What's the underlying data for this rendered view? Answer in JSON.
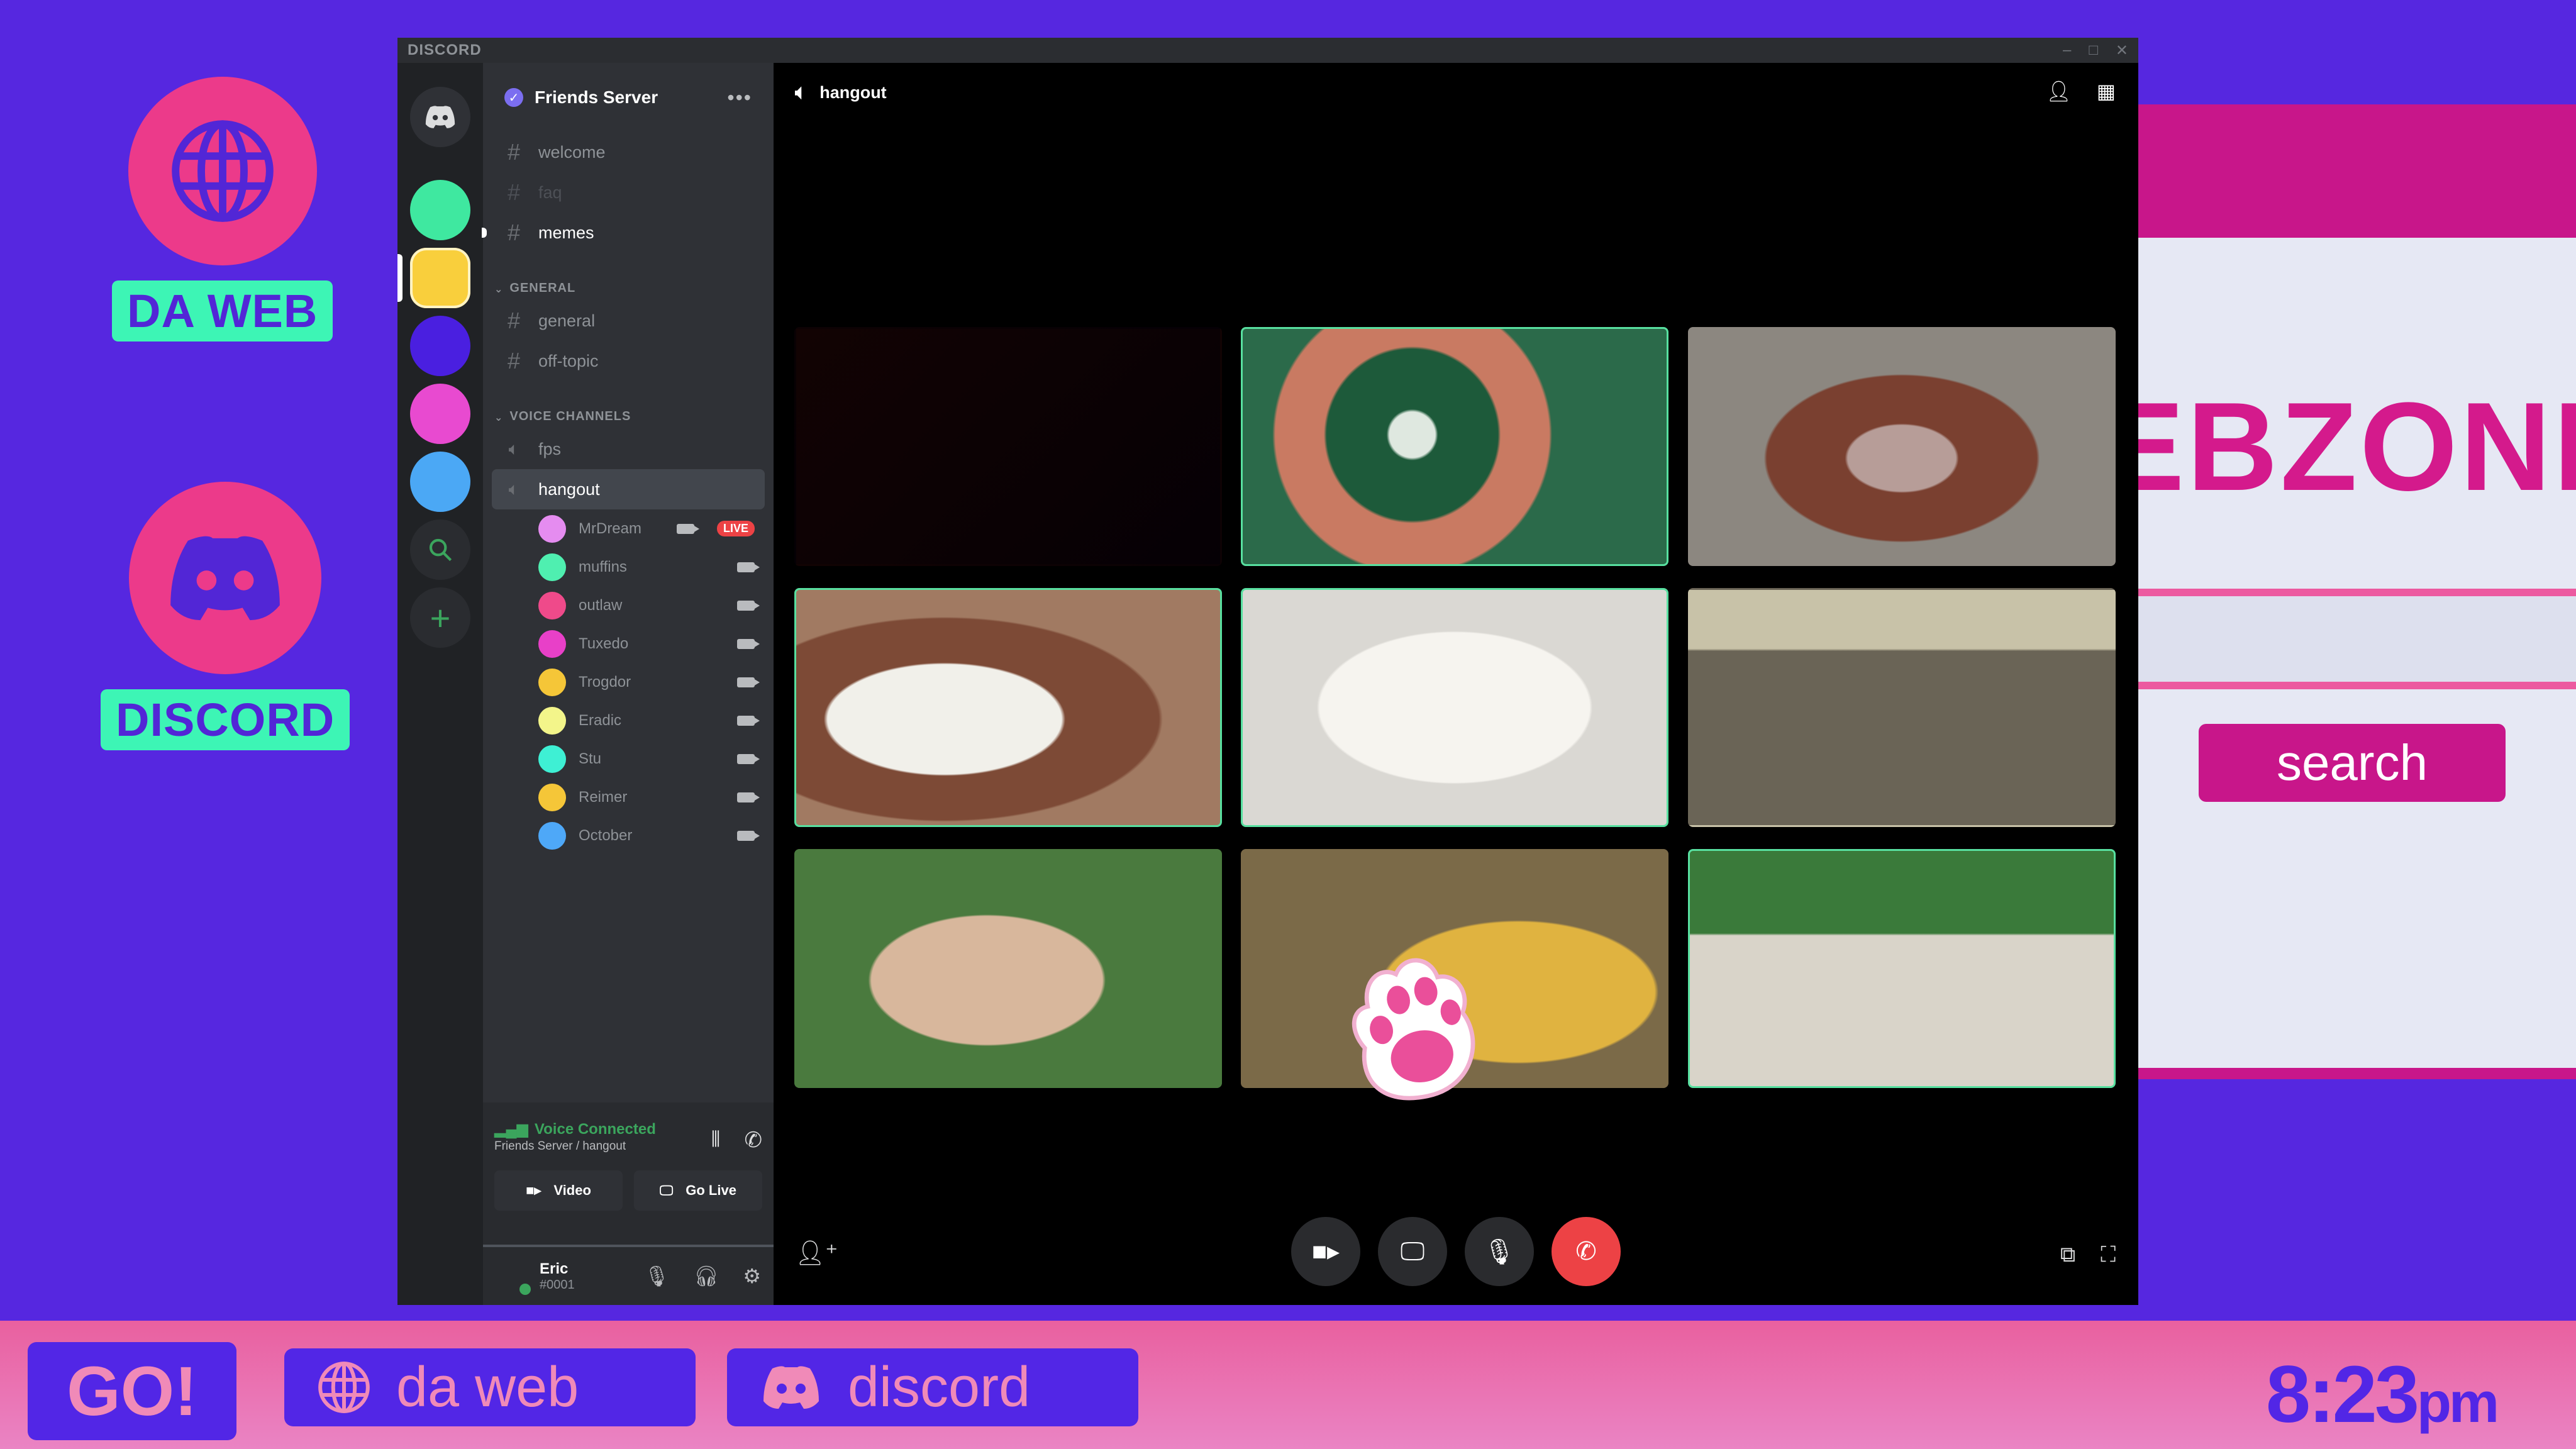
{
  "desktop": {
    "launchers": [
      {
        "label": "DA WEB",
        "icon": "globe-icon"
      },
      {
        "label": "DISCORD",
        "icon": "discord-logo-icon"
      }
    ],
    "colors": {
      "background": "#5627e0",
      "launcher_circle": "#ec3a8a",
      "launcher_tag": "#3df5b5"
    }
  },
  "webzone": {
    "logo_text": "EBZONE",
    "search_button": "search",
    "colors": {
      "brand": "#c8168a",
      "page": "#e6e8f4"
    }
  },
  "discord": {
    "window_title": "DISCORD",
    "window_controls": [
      "–",
      "□",
      "✕"
    ],
    "server_rail": {
      "home_icon": "discord-logo-icon",
      "servers": [
        {
          "color": "#3fe8a0",
          "active": false
        },
        {
          "color": "#f9cf3c",
          "active": true
        },
        {
          "color": "#4a1fe0",
          "active": false
        },
        {
          "color": "#e84ad0",
          "active": false
        },
        {
          "color": "#4ba8f5",
          "active": false
        }
      ],
      "tools": [
        {
          "name": "explore",
          "glyph": "⌕"
        },
        {
          "name": "add-server",
          "glyph": "+"
        }
      ]
    },
    "server": {
      "name": "Friends Server",
      "more_glyph": "•••",
      "channels": [
        {
          "name": "welcome",
          "state": "normal"
        },
        {
          "name": "faq",
          "state": "muted"
        },
        {
          "name": "memes",
          "state": "unread"
        }
      ],
      "categories": [
        {
          "name": "GENERAL",
          "channels": [
            {
              "name": "general"
            },
            {
              "name": "off-topic"
            }
          ]
        }
      ],
      "voice_category": "VOICE CHANNELS",
      "voice_channels": [
        {
          "name": "fps",
          "selected": false
        },
        {
          "name": "hangout",
          "selected": true
        }
      ],
      "members": [
        {
          "name": "MrDream",
          "color": "#e58cf0",
          "live": true
        },
        {
          "name": "muffins",
          "color": "#4fefb0",
          "live": false
        },
        {
          "name": "outlaw",
          "color": "#ef4a8a",
          "live": false
        },
        {
          "name": "Tuxedo",
          "color": "#e840c8",
          "live": false
        },
        {
          "name": "Trogdor",
          "color": "#f5c638",
          "live": false
        },
        {
          "name": "Eradic",
          "color": "#f3f58a",
          "live": false
        },
        {
          "name": "Stu",
          "color": "#3ef0d4",
          "live": false
        },
        {
          "name": "Reimer",
          "color": "#f5c638",
          "live": false
        },
        {
          "name": "October",
          "color": "#4ea8f8",
          "live": false
        }
      ],
      "live_label": "LIVE"
    },
    "voice_panel": {
      "status": "Voice Connected",
      "location": "Friends Server / hangout",
      "video_button": "Video",
      "golive_button": "Go Live"
    },
    "user": {
      "name": "Eric",
      "tag": "#0001",
      "status_color": "#3ba55d"
    },
    "call": {
      "channel": "hangout",
      "tiles": [
        {
          "subject": "empty",
          "speaking": false
        },
        {
          "subject": "cat close-up",
          "speaking": true
        },
        {
          "subject": "orangutan",
          "speaking": false
        },
        {
          "subject": "duck",
          "speaking": true
        },
        {
          "subject": "pomeranian",
          "speaking": true
        },
        {
          "subject": "monkeys",
          "speaking": false
        },
        {
          "subject": "monkey",
          "speaking": false
        },
        {
          "subject": "iguana",
          "speaking": false
        },
        {
          "subject": "giraffe",
          "speaking": true
        }
      ],
      "controls": [
        "camera",
        "screen-share",
        "microphone",
        "disconnect"
      ]
    }
  },
  "taskbar": {
    "go_label": "GO!",
    "web_label": "da web",
    "discord_label": "discord",
    "clock_time": "8:23",
    "clock_ampm": "pm"
  }
}
